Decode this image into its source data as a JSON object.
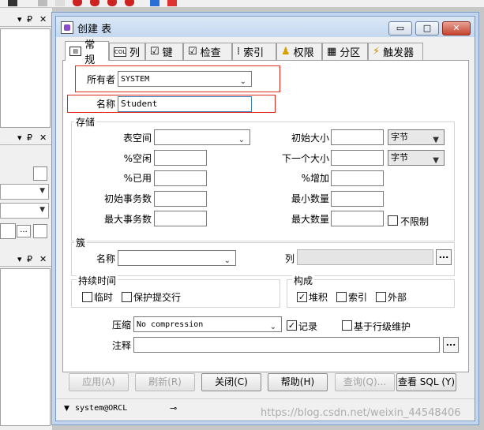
{
  "window": {
    "title": "创建 表"
  },
  "title_buttons": {
    "minimize": "▭",
    "maximize": "□",
    "close": "✕"
  },
  "tabs": [
    {
      "label": "常规",
      "icon": "general-icon"
    },
    {
      "label": "列",
      "icon": "column-icon"
    },
    {
      "label": "键",
      "icon": "key-icon"
    },
    {
      "label": "检查",
      "icon": "check-icon"
    },
    {
      "label": "索引",
      "icon": "index-icon"
    },
    {
      "label": "权限",
      "icon": "privilege-icon"
    },
    {
      "label": "分区",
      "icon": "partition-icon"
    },
    {
      "label": "触发器",
      "icon": "trigger-icon"
    }
  ],
  "general": {
    "owner_label": "所有者",
    "owner_value": "SYSTEM",
    "name_label": "名称",
    "name_value": "Student"
  },
  "storage": {
    "title": "存储",
    "tablespace_label": "表空间",
    "pct_free_label": "%空闲",
    "pct_used_label": "%已用",
    "ini_trans_label": "初始事务数",
    "max_trans_label": "最大事务数",
    "initial_label": "初始大小",
    "next_label": "下一个大小",
    "pct_increase_label": "%增加",
    "min_extents_label": "最小数量",
    "max_extents_label": "最大数量",
    "unit_initial": "字节",
    "unit_next": "字节",
    "unlimited_label": "不限制"
  },
  "cluster": {
    "title": "簇",
    "name_label": "名称",
    "column_label": "列"
  },
  "duration": {
    "title": "持续时间",
    "temporary_label": "临时",
    "preserve_label": "保护提交行"
  },
  "organization": {
    "title": "构成",
    "heap_label": "堆积",
    "index_label": "索引",
    "external_label": "外部"
  },
  "compression": {
    "label": "压缩",
    "value": "No compression",
    "logging_label": "记录",
    "row_movement_label": "基于行级维护"
  },
  "comment": {
    "label": "注释"
  },
  "buttons": {
    "apply": "应用(A)",
    "refresh": "刷新(R)",
    "close": "关闭(C)",
    "help": "帮助(H)",
    "query": "查询(Q)...",
    "view_sql": "查看 SQL (Y)"
  },
  "status": {
    "connection": "system@ORCL"
  },
  "watermark": "https://blog.csdn.net/weixin_44548406",
  "colors": {
    "highlight_border": "#e0261c",
    "title_bar": "#c4d8f0"
  }
}
